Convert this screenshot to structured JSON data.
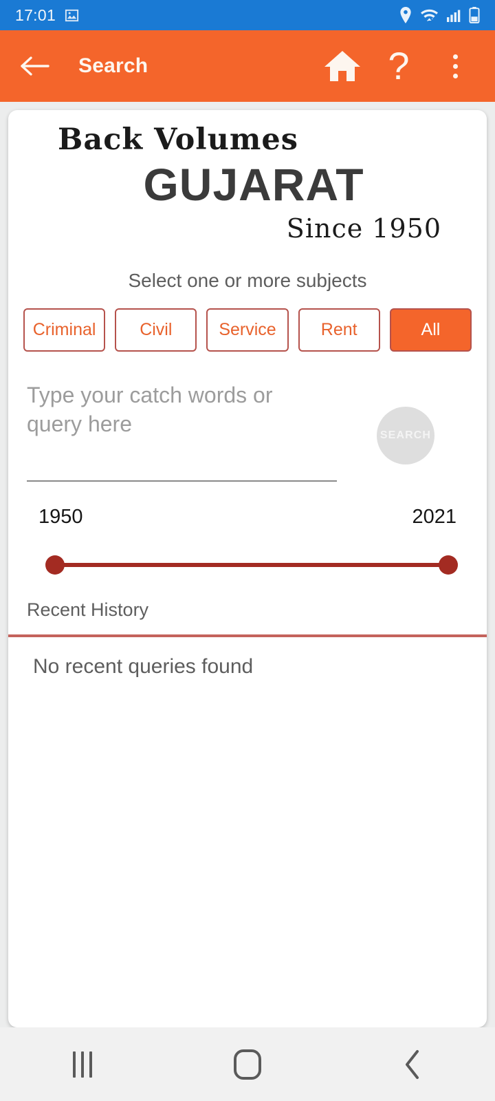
{
  "status_bar": {
    "time": "17:01",
    "icons": [
      "image-icon",
      "location-pin-icon",
      "wifi-icon",
      "signal-bars-icon",
      "battery-icon"
    ],
    "background_color": "#1a7ad4"
  },
  "app_bar": {
    "back_label": "back-arrow",
    "title": "Search",
    "actions": [
      "home-icon",
      "help-icon",
      "overflow-menu-icon"
    ],
    "background_color": "#f4652b"
  },
  "logo": {
    "line1": "Back Volumes",
    "line2": "GUJARAT",
    "line3": "Since 1950"
  },
  "subjects": {
    "prompt": "Select one or more subjects",
    "chips": [
      {
        "label": "Criminal",
        "selected": false
      },
      {
        "label": "Civil",
        "selected": false
      },
      {
        "label": "Service",
        "selected": false
      },
      {
        "label": "Rent",
        "selected": false
      },
      {
        "label": "All",
        "selected": true
      }
    ],
    "border_color": "#b5524c",
    "text_color": "#e8622c",
    "selected_background": "#f4652b"
  },
  "search": {
    "placeholder": "Type your catch words or query here",
    "value": "",
    "button_label": "SEARCH",
    "button_color": "#dedede"
  },
  "year_range": {
    "min_label": "1950",
    "max_label": "2021",
    "min_value": 1950,
    "max_value": 2021,
    "selected_min": 1950,
    "selected_max": 2021,
    "accent_color": "#a32b22"
  },
  "history": {
    "title": "Recent History",
    "empty_message": "No recent queries found",
    "divider_color": "#c4635c"
  },
  "nav_bar": {
    "recents_label": "recent-apps",
    "home_label": "home",
    "back_label": "back"
  }
}
